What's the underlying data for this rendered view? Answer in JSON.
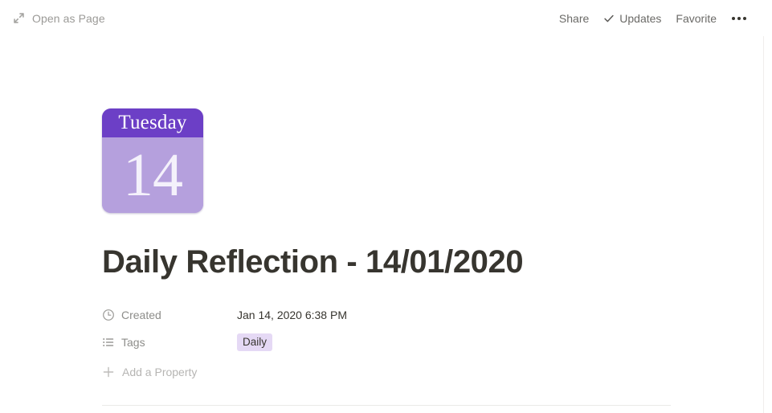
{
  "topbar": {
    "open_as_page": {
      "label": "Open as Page",
      "icon": "expand-diagonal-icon"
    },
    "actions": [
      {
        "label": "Share",
        "icon": null
      },
      {
        "label": "Updates",
        "icon": "check-icon"
      },
      {
        "label": "Favorite",
        "icon": null
      }
    ],
    "more_menu": {
      "label": "More options",
      "icon": "ellipsis-icon"
    }
  },
  "page": {
    "icon": {
      "type": "calendar-icon",
      "weekday": "Tuesday",
      "day": "14",
      "header_color": "#6c3fc6",
      "body_color": "#b5a0dd"
    },
    "title": "Daily Reflection - 14/01/2020"
  },
  "properties": {
    "rows": [
      {
        "icon": "clock-icon",
        "key": "Created",
        "value": "Jan 14, 2020 6:38 PM",
        "type": "date"
      },
      {
        "icon": "list-icon",
        "key": "Tags",
        "value": "Daily",
        "type": "multi-select",
        "tag_color": "#e5d9f5"
      }
    ],
    "add_property": {
      "label": "Add a Property",
      "icon": "plus-icon"
    }
  }
}
